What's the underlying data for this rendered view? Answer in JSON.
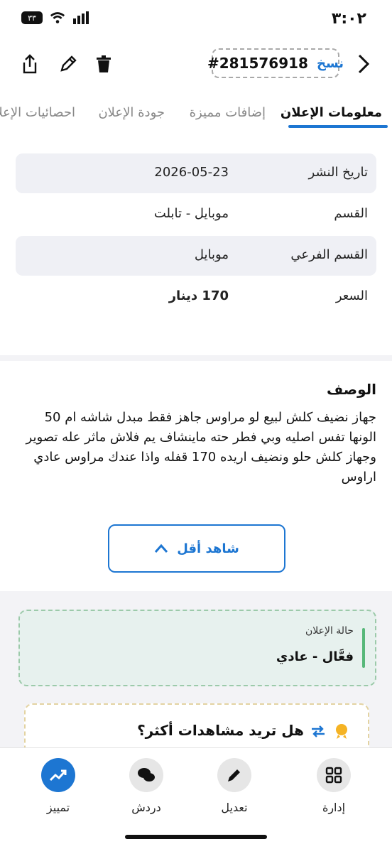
{
  "status_bar": {
    "time": "٣:٠٢",
    "battery": "٣٣"
  },
  "header": {
    "ad_id": "#281576918",
    "copy_label": "نسخ"
  },
  "tabs": [
    {
      "label": "معلومات الإعلان"
    },
    {
      "label": "إضافات مميزة"
    },
    {
      "label": "جودة الإعلان"
    },
    {
      "label": "احصائيات الإعلان"
    }
  ],
  "info": {
    "rows": [
      {
        "label": "تاريخ النشر",
        "value": "2026-05-23"
      },
      {
        "label": "القسم",
        "value": "موبايل - تابلت"
      },
      {
        "label": "القسم الفرعي",
        "value": "موبايل"
      },
      {
        "label": "السعر",
        "value": "170 دينار"
      }
    ]
  },
  "description": {
    "title": "الوصف",
    "text": "جهاز نضيف كلش لبيع لو مراوس جاهز فقط مبدل شاشه ام 50 الونها تفس اصليه وبي فطر حته ماينشاف يم فلاش ماثر عله تصوير وجهاز كلش حلو ونضيف اريده 170 قفله واذا عندك مراوس عادي اراوس",
    "see_less": "شاهد أقل"
  },
  "status_card": {
    "label": "حالة الإعلان",
    "value": "فعَّال - عادي"
  },
  "promo": {
    "title": "هل تريد مشاهدات أكثر؟"
  },
  "bottom_nav": [
    {
      "label": "إدارة"
    },
    {
      "label": "تعديل"
    },
    {
      "label": "دردش"
    },
    {
      "label": "تمييز"
    }
  ],
  "colors": {
    "accent": "#1d76d2",
    "status_bar": "#57b879"
  }
}
